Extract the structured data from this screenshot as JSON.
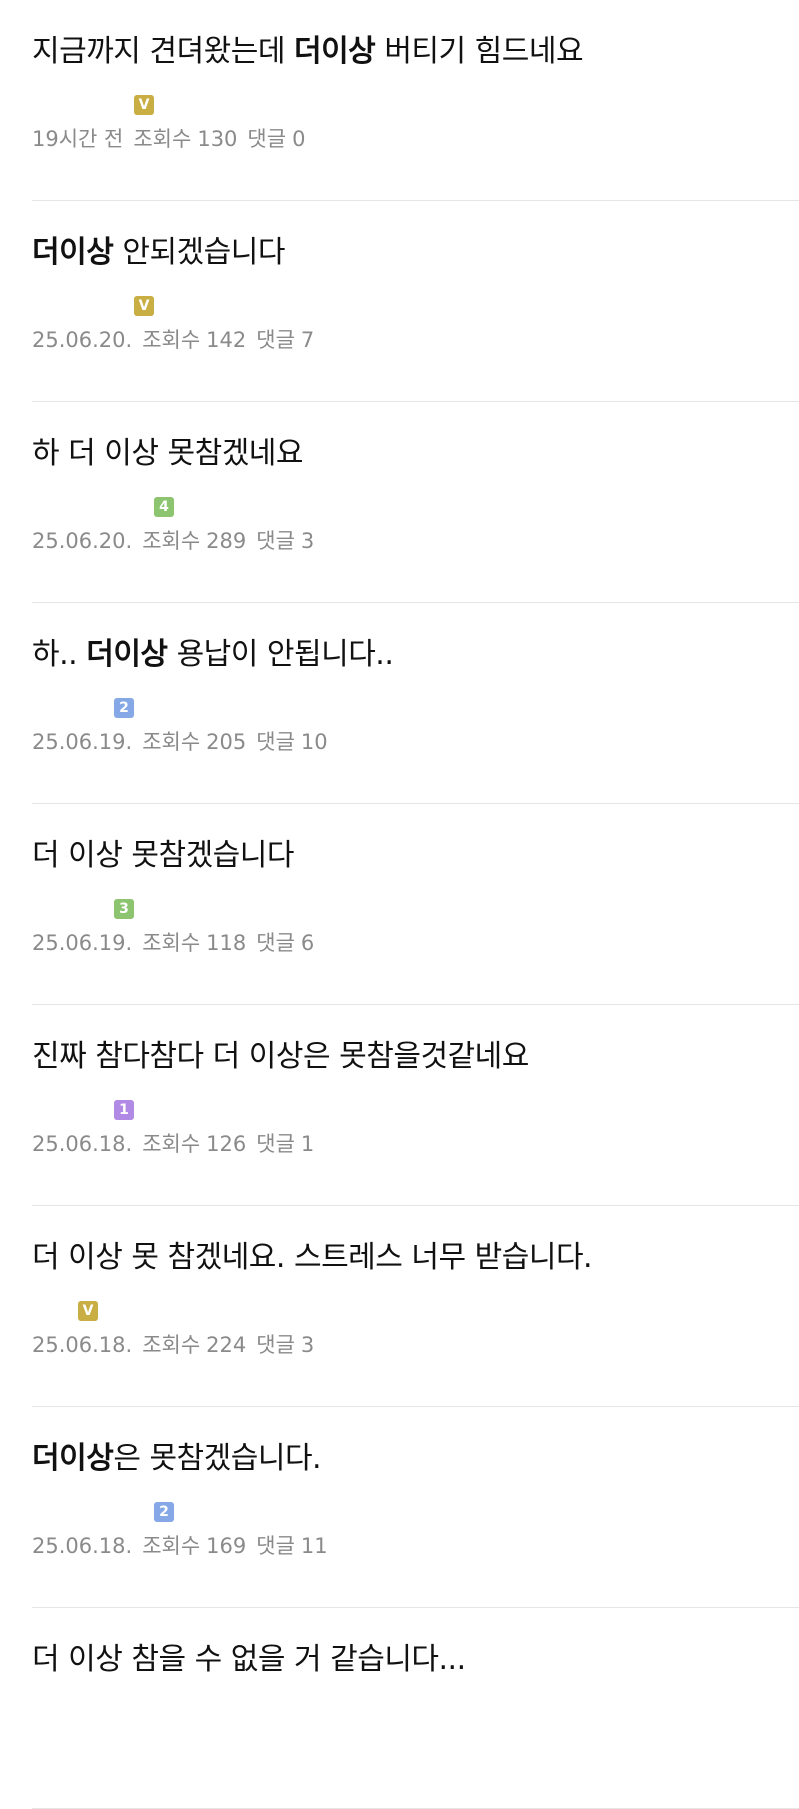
{
  "posts": [
    {
      "title_parts": [
        "지금까지 견뎌왔는데 ",
        "더이상",
        " 버티기 힘드네요"
      ],
      "author": "",
      "badge": "V",
      "badge_color": "#c9ae43",
      "date": "19시간 전",
      "views_label": "조회수",
      "views": "130",
      "comments_label": "댓글",
      "comments": "0"
    },
    {
      "title_parts": [
        "",
        "더이상",
        " 안되겠습니다"
      ],
      "author": "",
      "badge": "V",
      "badge_color": "#c9ae43",
      "date": "25.06.20.",
      "views_label": "조회수",
      "views": "142",
      "comments_label": "댓글",
      "comments": "7"
    },
    {
      "title_parts": [
        "하 더 이상 못참겠네요",
        "",
        ""
      ],
      "author": "",
      "badge": "4",
      "badge_color": "#8cc46f",
      "date": "25.06.20.",
      "views_label": "조회수",
      "views": "289",
      "comments_label": "댓글",
      "comments": "3"
    },
    {
      "title_parts": [
        "하.. ",
        "더이상",
        " 용납이 안됩니다.."
      ],
      "author": "",
      "badge": "2",
      "badge_color": "#86a8e6",
      "date": "25.06.19.",
      "views_label": "조회수",
      "views": "205",
      "comments_label": "댓글",
      "comments": "10"
    },
    {
      "title_parts": [
        "더 이상 못참겠습니다",
        "",
        ""
      ],
      "author": "",
      "badge": "3",
      "badge_color": "#8cc46f",
      "date": "25.06.19.",
      "views_label": "조회수",
      "views": "118",
      "comments_label": "댓글",
      "comments": "6"
    },
    {
      "title_parts": [
        "진짜 참다참다 더 이상은 못참을것같네요",
        "",
        ""
      ],
      "author": "",
      "badge": "1",
      "badge_color": "#b18ae6",
      "date": "25.06.18.",
      "views_label": "조회수",
      "views": "126",
      "comments_label": "댓글",
      "comments": "1"
    },
    {
      "title_parts": [
        "더 이상 못 참겠네요. 스트레스 너무 받습니다.",
        "",
        ""
      ],
      "author": "",
      "badge": "V",
      "badge_color": "#c9ae43",
      "date": "25.06.18.",
      "views_label": "조회수",
      "views": "224",
      "comments_label": "댓글",
      "comments": "3"
    },
    {
      "title_parts": [
        "",
        "더이상",
        "은 못참겠습니다."
      ],
      "author": "",
      "badge": "2",
      "badge_color": "#86a8e6",
      "date": "25.06.18.",
      "views_label": "조회수",
      "views": "169",
      "comments_label": "댓글",
      "comments": "11"
    },
    {
      "title_parts": [
        "더 이상 참을 수 없을 거 같습니다...",
        "",
        ""
      ],
      "author": "",
      "badge": "",
      "badge_color": "#c9ae43",
      "date": "",
      "views_label": "",
      "views": "",
      "comments_label": "",
      "comments": ""
    }
  ]
}
